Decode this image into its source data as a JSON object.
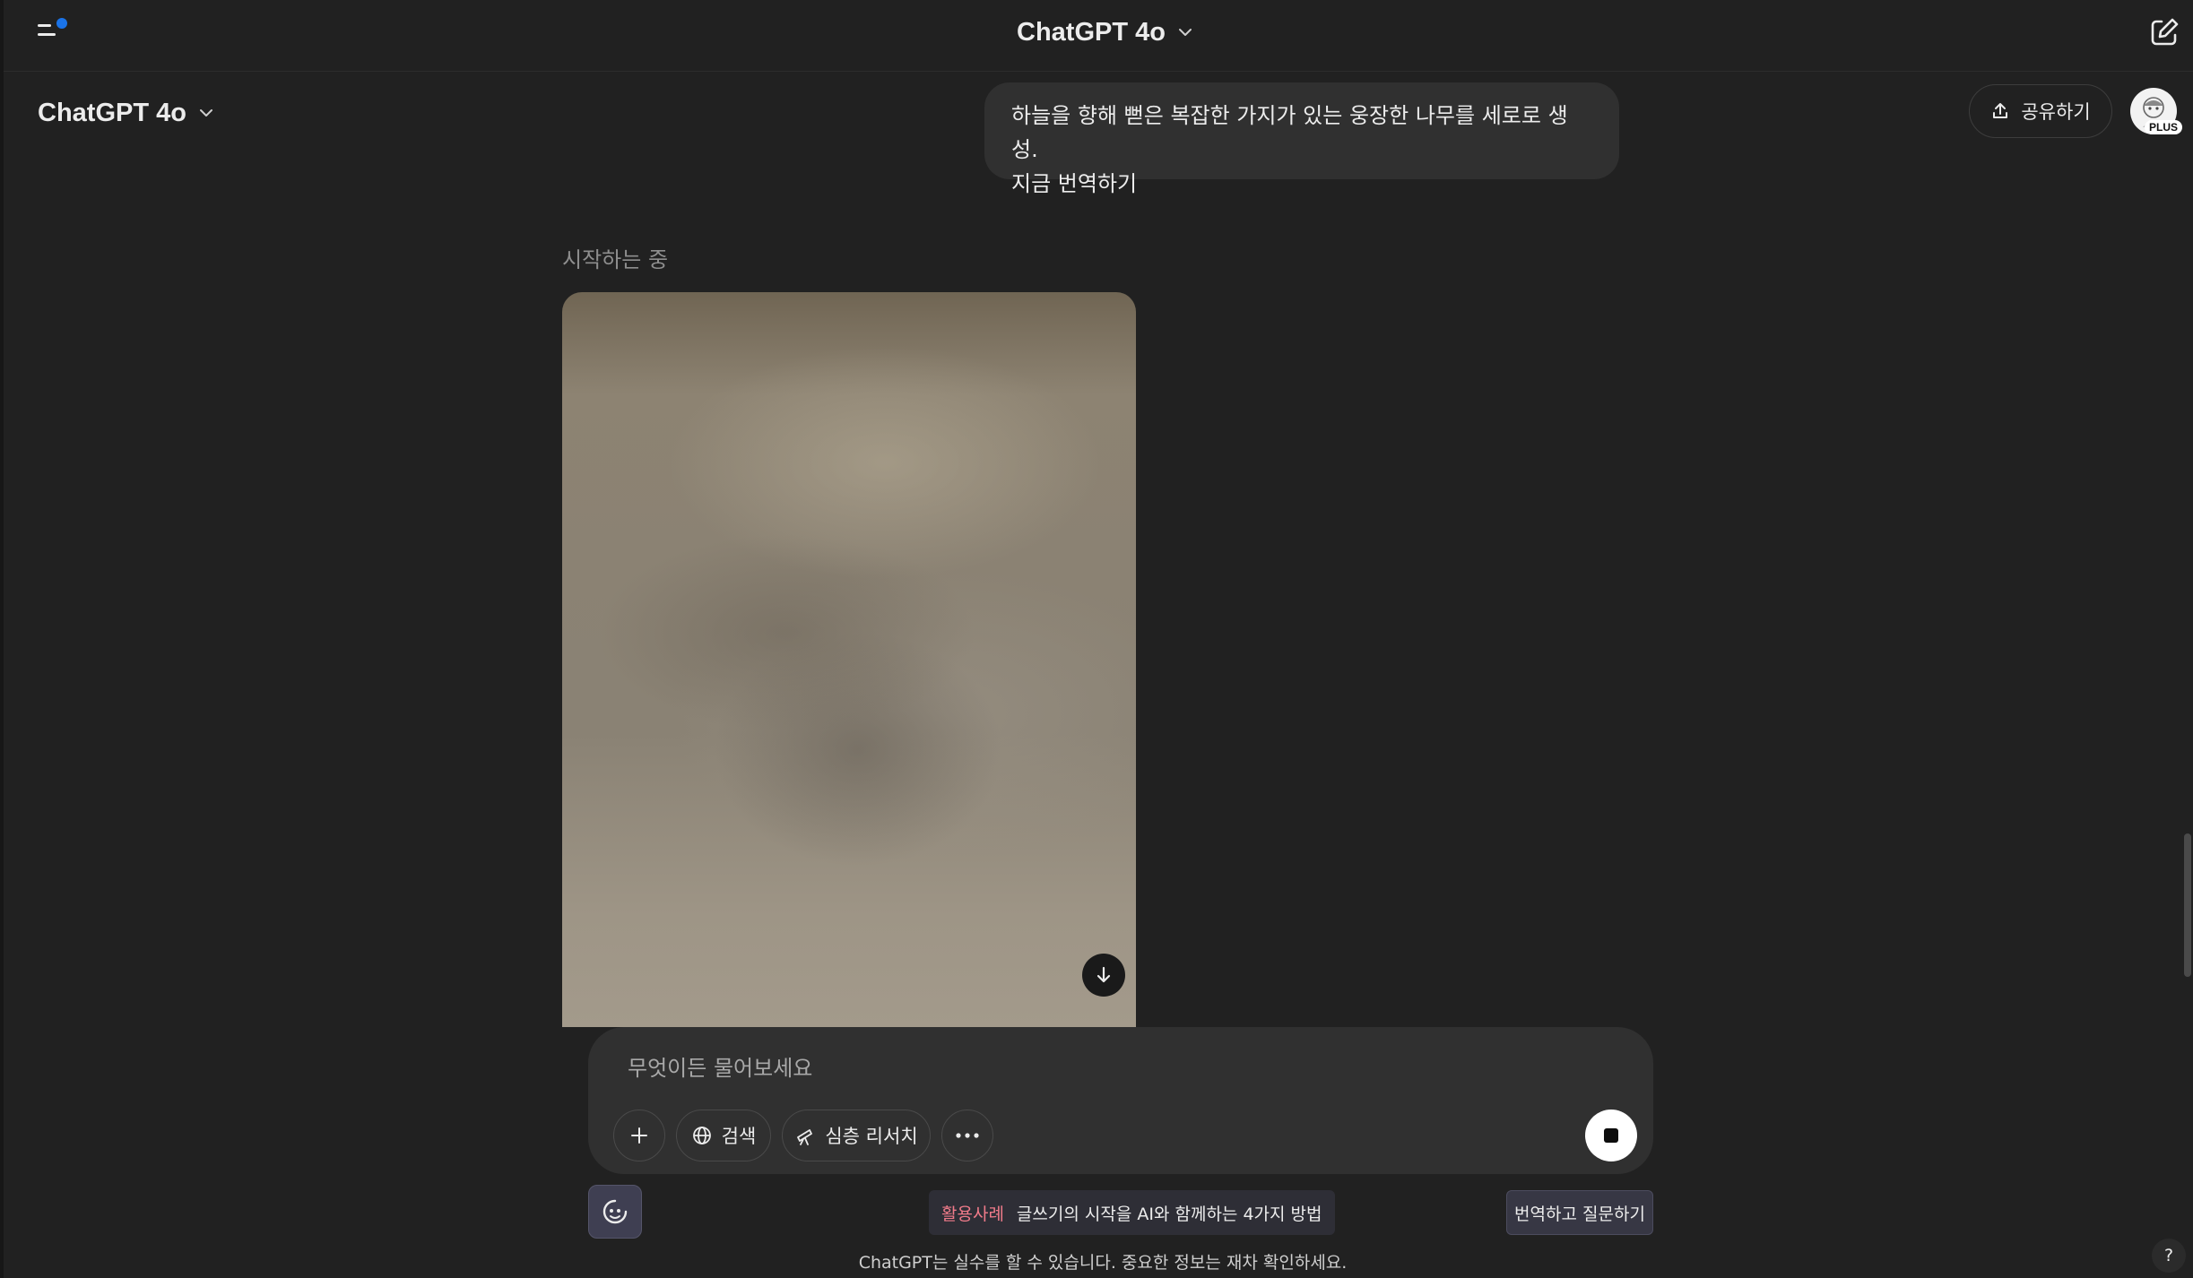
{
  "header": {
    "title": "ChatGPT 4o",
    "notification_color": "#1a73e8"
  },
  "model_picker": {
    "label": "ChatGPT 4o"
  },
  "share_button": {
    "label": "공유하기"
  },
  "avatar": {
    "badge": "PLUS"
  },
  "conversation": {
    "user_message": {
      "line1": "하늘을 향해 뻗은 복잡한 가지가 있는 웅장한 나무를 세로로 생성.",
      "line2": "지금 번역하기"
    },
    "assistant_status": "시작하는 중"
  },
  "composer": {
    "placeholder": "무엇이든 물어보세요",
    "tools": {
      "search_label": "검색",
      "deep_research_label": "심층 리서치"
    }
  },
  "footer": {
    "promo_tag": "활용사례",
    "promo_text": "글쓰기의 시작을 AI와 함께하는 4가지 방법",
    "translate_button": "번역하고 질문하기",
    "disclaimer": "ChatGPT는 실수를 할 수 있습니다. 중요한 정보는 재차 확인하세요.",
    "help_label": "?"
  }
}
